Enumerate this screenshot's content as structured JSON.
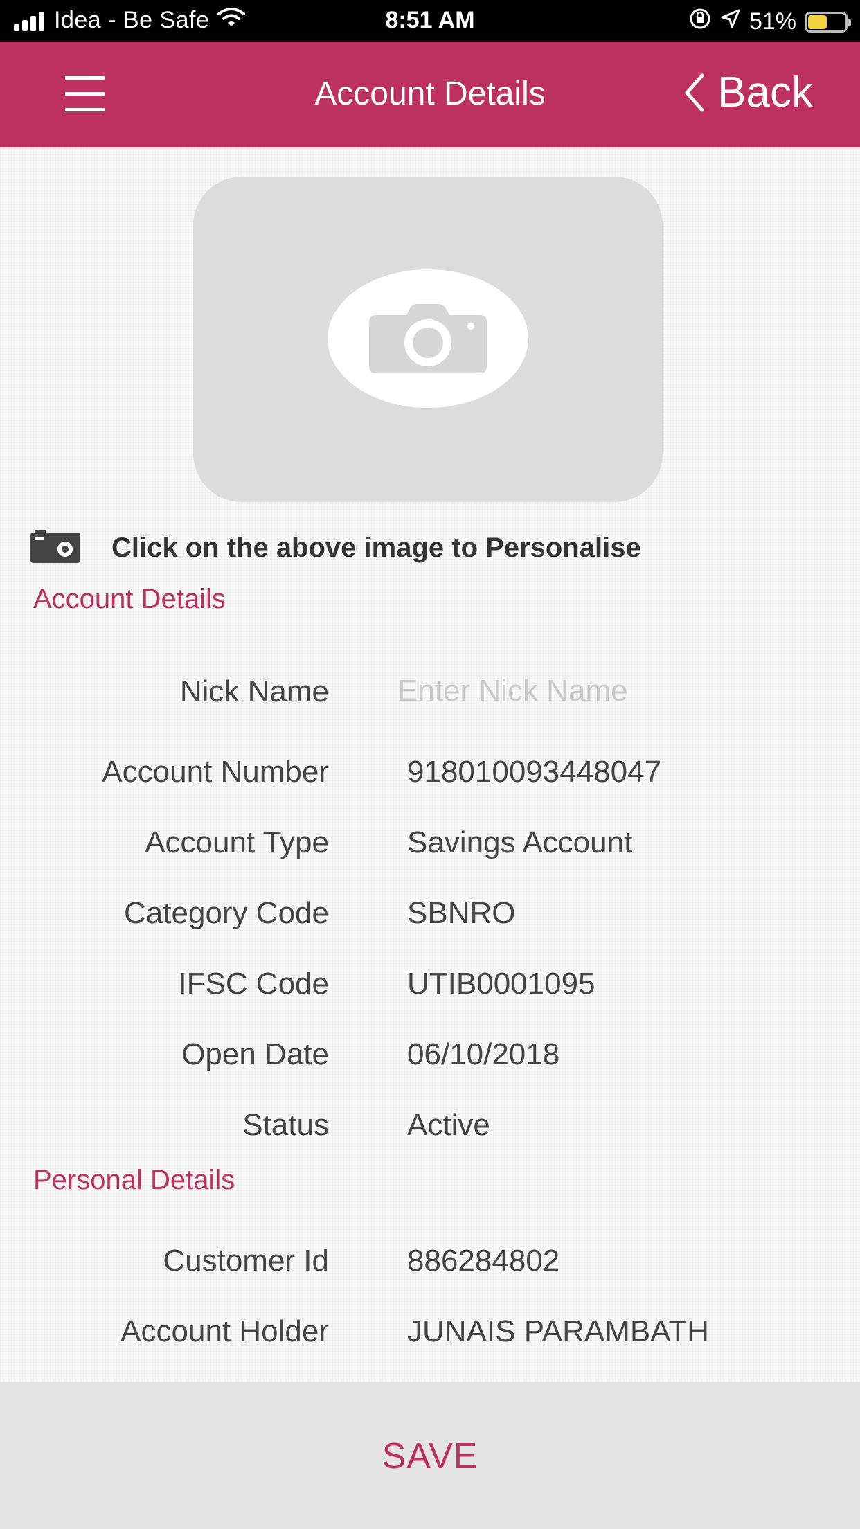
{
  "status_bar": {
    "carrier": "Idea - Be Safe",
    "time": "8:51 AM",
    "battery": "51%",
    "battery_level": 0.51,
    "icons": [
      "signal-icon",
      "wifi-icon",
      "orientation-lock-icon",
      "location-icon",
      "battery-icon"
    ]
  },
  "header": {
    "title": "Account Details",
    "back_label": "Back",
    "icons": [
      "menu-icon",
      "chevron-left-icon"
    ]
  },
  "photo": {
    "icon": "camera-icon",
    "hint": "Click on the above image to Personalise"
  },
  "account_section": {
    "title": "Account Details",
    "nick_name": {
      "label": "Nick Name",
      "value": "",
      "placeholder": "Enter Nick Name"
    },
    "rows": [
      {
        "label": "Account Number",
        "value": "918010093448047"
      },
      {
        "label": "Account Type",
        "value": "Savings Account"
      },
      {
        "label": "Category Code",
        "value": "SBNRO"
      },
      {
        "label": "IFSC Code",
        "value": "UTIB0001095"
      },
      {
        "label": "Open Date",
        "value": "06/10/2018"
      },
      {
        "label": "Status",
        "value": "Active"
      }
    ]
  },
  "personal_section": {
    "title": "Personal Details",
    "rows": [
      {
        "label": "Customer Id",
        "value": "886284802"
      },
      {
        "label": "Account Holder",
        "value": "JUNAIS  PARAMBATH"
      }
    ]
  },
  "footer": {
    "save_label": "SAVE"
  },
  "colors": {
    "brand": "#bd3160",
    "footer_bg": "#e4e4e4",
    "photo_bg": "#dcdcdc"
  }
}
